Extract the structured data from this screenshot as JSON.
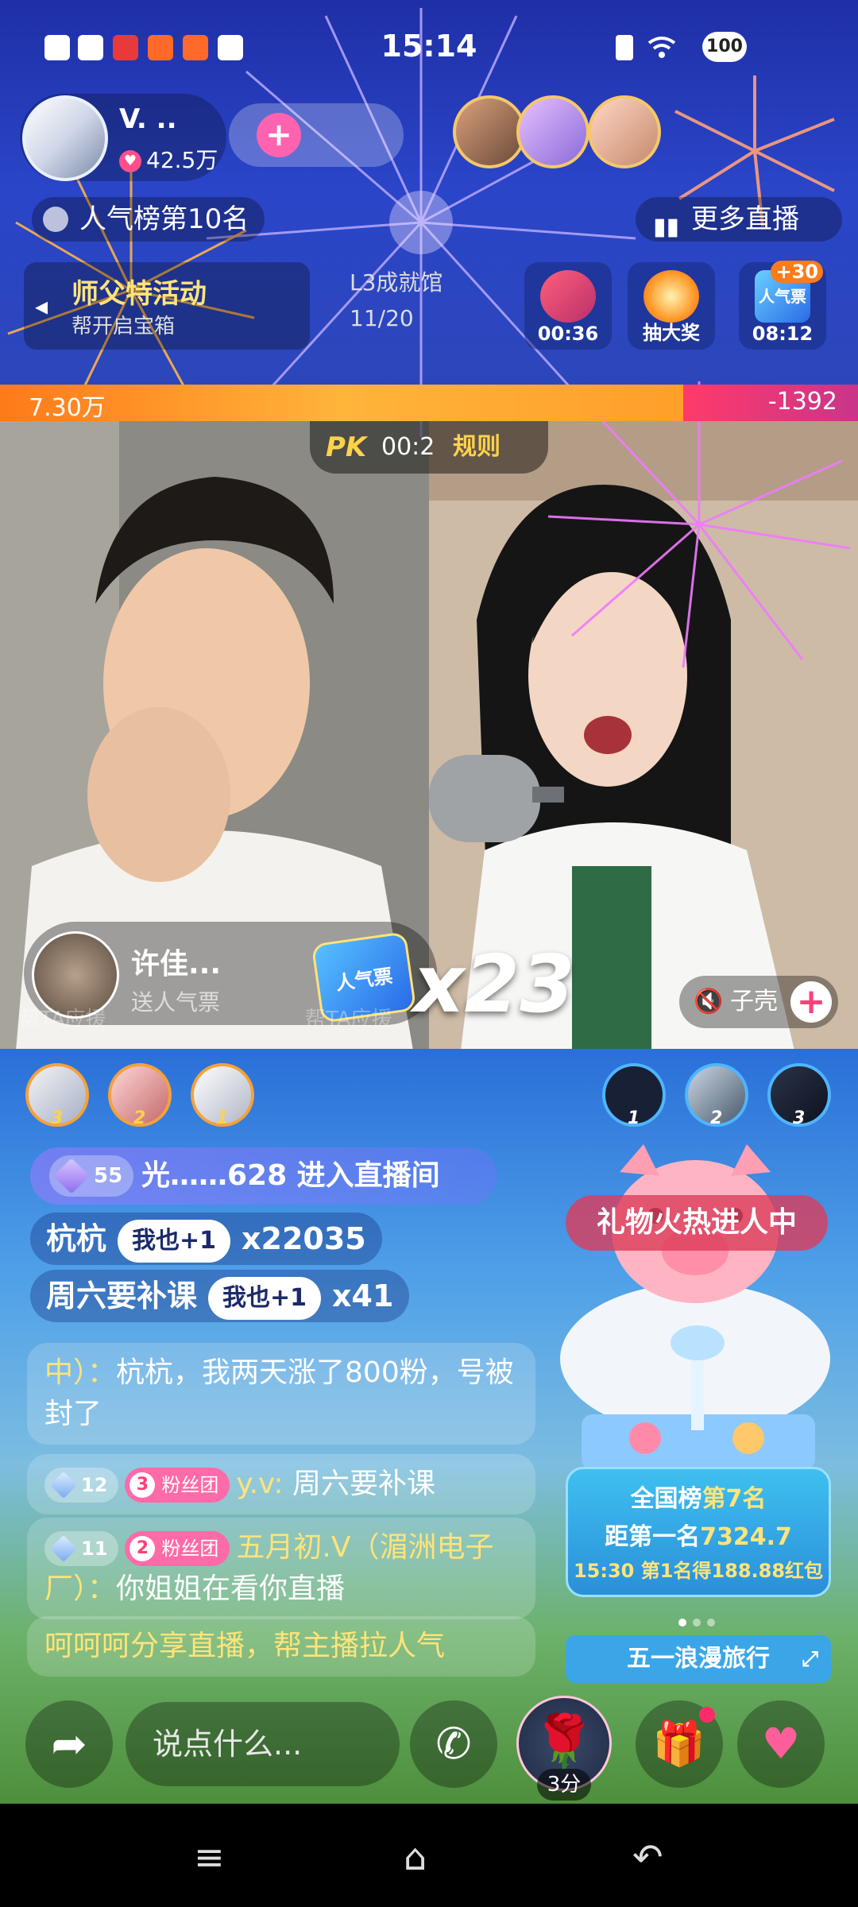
{
  "status_bar": {
    "time": "15:14",
    "battery": "100"
  },
  "header": {
    "host_name": "V.  ..",
    "host_likes": "42.5万",
    "rank_text": "人气榜第10名",
    "more_text": "更多直播"
  },
  "banner": {
    "left_title": "师父特活动",
    "left_sub": "帮开启宝箱",
    "mid_title": "L3成就馆",
    "mid_sub": "11/20"
  },
  "features": [
    {
      "label": "00:36"
    },
    {
      "label": "抽大奖"
    },
    {
      "label": "08:12",
      "badge": "+30",
      "icon": "人气票"
    }
  ],
  "pk": {
    "left_score": "7.30万",
    "right_score": "-1392",
    "pk_label": "PK",
    "timer": "00:2",
    "rule": "规则"
  },
  "gift_notice": {
    "user": "许佳...",
    "action": "送人气票",
    "gift_icon": "人气票",
    "combo": "x23",
    "help_text": "帮TA应援"
  },
  "mute_pill": {
    "name": "子壳"
  },
  "rank_left": [
    "3",
    "2",
    "1"
  ],
  "rank_right": [
    "1",
    "2",
    "3"
  ],
  "chat": {
    "enter": {
      "level": "55",
      "text": "光……628 进入直播间"
    },
    "row1": {
      "name": "杭杭",
      "btn": "我也+1",
      "count": "x22035"
    },
    "row2": {
      "name": "周六要补课",
      "btn": "我也+1",
      "count": "x41"
    },
    "msg1": {
      "name": "中）：",
      "text": "杭杭，我两天涨了800粉，号被封了"
    },
    "msg2": {
      "level": "12",
      "fan_level": "3",
      "fan": "粉丝团",
      "name": "y.v:",
      "text": "周六要补课"
    },
    "msg3": {
      "level": "11",
      "fan_level": "2",
      "fan": "粉丝团",
      "name": "五月初.V（湄洲电子厂）：",
      "text": "你姐姐在看你直播"
    },
    "msg4": {
      "text": "呵呵呵分享直播，帮主播拉人气"
    }
  },
  "promo": {
    "gift_hot": "礼物火热进人中",
    "rank_line1_a": "全国榜",
    "rank_line1_b": "第7名",
    "rank_line2_a": "距第一名",
    "rank_line2_b": "7324.7",
    "rank_line3": "15:30 第1名得188.88红包",
    "trip": "五一浪漫旅行"
  },
  "toolbar": {
    "placeholder": "说点什么...",
    "rose_time": "3分"
  },
  "icons": {
    "share": "share-icon",
    "call": "phone-icon",
    "gift": "gift-icon",
    "heart": "heart-plus-icon"
  }
}
